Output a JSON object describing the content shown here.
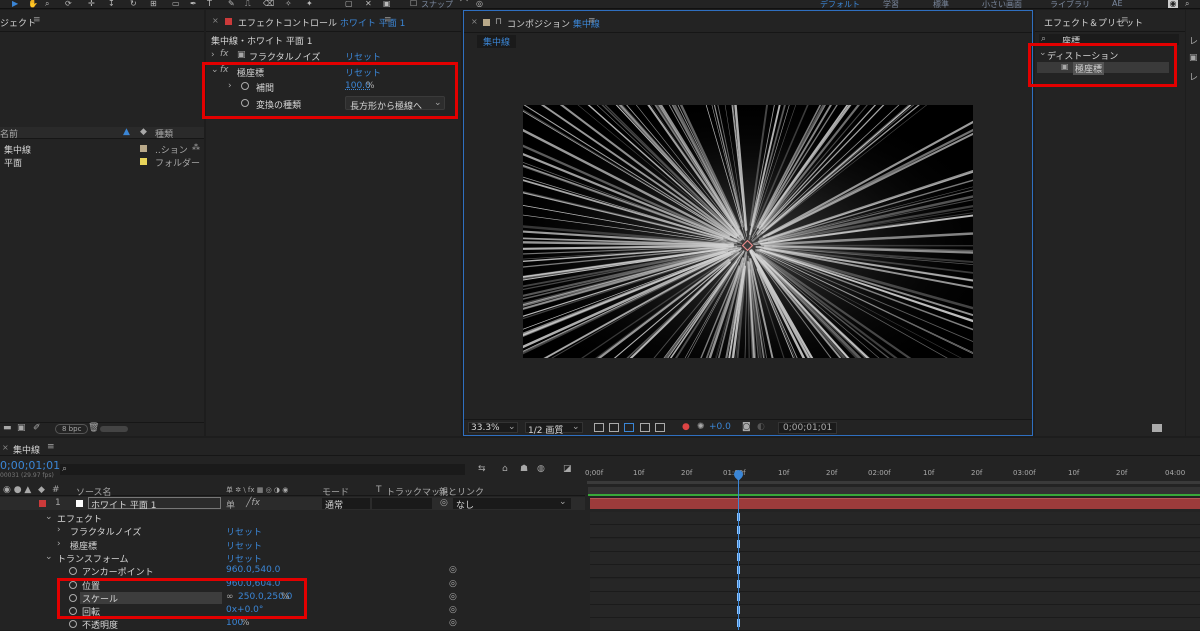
{
  "toolbar": {
    "snap_label": "スナップ",
    "workspaces": [
      "デフォルト",
      "学習",
      "標準",
      "小さい画面",
      "ライブラリ",
      "AE"
    ]
  },
  "project": {
    "title": "ジェクト",
    "col_name": "名前",
    "col_type": "種類",
    "items": [
      {
        "name": "集中線",
        "type": "..ション",
        "color": "#b9a989"
      },
      {
        "name": "平面",
        "type": "フォルダー",
        "color": "#e8d45a"
      }
    ],
    "bpc": "8 bpc"
  },
  "effect_controls": {
    "tab_label": "エフェクトコントロール",
    "tab_layer": "ホワイト 平面 1",
    "breadcrumb": "集中線・ホワイト 平面 1",
    "effects": [
      {
        "name": "フラクタルノイズ",
        "reset": "リセット"
      },
      {
        "name": "極座標",
        "reset": "リセット"
      }
    ],
    "params": {
      "interp_label": "補間",
      "interp_value": "100.0",
      "interp_unit": "%",
      "conv_label": "変換の種類",
      "conv_value": "長方形から極線へ"
    }
  },
  "composition": {
    "tab_label": "コンポジション",
    "tab_comp": "集中線",
    "sub_tab": "集中線",
    "zoom": "33.3%",
    "resolution": "1/2 画質",
    "exposure": "+0.0",
    "timecode": "0;00;01;01"
  },
  "effects_presets": {
    "title": "エフェクト＆プリセット",
    "search": "座標",
    "category": "ディストーション",
    "result": "極座標"
  },
  "timeline": {
    "tab_label": "集中線",
    "timecode": "0;00;01;01",
    "fps": "00031 (29.97 fps)",
    "col_source": "ソース名",
    "col_mode": "モード",
    "col_t": "T",
    "col_trackmatte": "トラックマット",
    "col_parent": "親とリンク",
    "layer": {
      "num": "1",
      "name": "ホワイト 平面 1",
      "mode": "通常",
      "parent": "なし"
    },
    "rows": [
      {
        "label": "エフェクト",
        "value": ""
      },
      {
        "label": "フラクタルノイズ",
        "value": "リセット"
      },
      {
        "label": "極座標",
        "value": "リセット"
      },
      {
        "label": "トランスフォーム",
        "value": "リセット"
      },
      {
        "label": "アンカーポイント",
        "value": "960.0,540.0"
      },
      {
        "label": "位置",
        "value": "960.0,604.0"
      },
      {
        "label": "スケール",
        "value": "250.0,250.0",
        "unit": "%"
      },
      {
        "label": "回転",
        "value": "0x+0.0°"
      },
      {
        "label": "不透明度",
        "value": "100",
        "unit": "%"
      }
    ],
    "ruler": [
      "0;00f",
      "10f",
      "20f",
      "01:00f",
      "10f",
      "20f",
      "02:00f",
      "10f",
      "20f",
      "03:00f",
      "10f",
      "20f",
      "04:00"
    ]
  }
}
